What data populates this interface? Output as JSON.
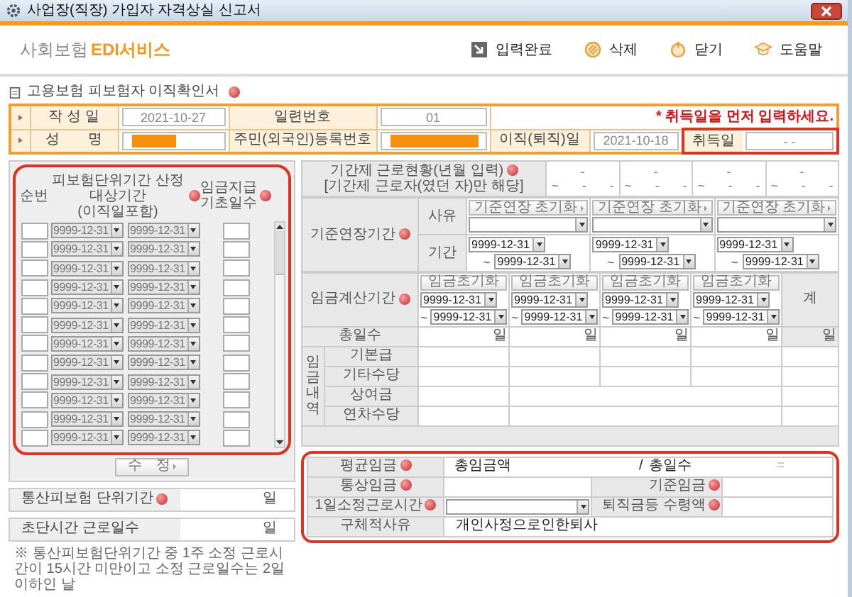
{
  "window": {
    "title": "사업장(직장) 가입자 자격상실 신고서"
  },
  "logo": {
    "prefix": "사회보험",
    "brand": "EDI서비스"
  },
  "toolbar": [
    {
      "kind": "submit",
      "label": "입력완료"
    },
    {
      "kind": "delete",
      "label": "삭제"
    },
    {
      "kind": "close",
      "label": "닫기"
    },
    {
      "kind": "help",
      "label": "도움말"
    }
  ],
  "section": {
    "title": "고용보험 피보험자 이직확인서"
  },
  "info": {
    "written": "작 성 일",
    "written_value": "2021-10-27",
    "serial": "일련번호",
    "serial_value": "01",
    "notice": "* 취득일을 먼저 입력하세요.",
    "name": "성　　명",
    "id": "주민(외국인)등록번호",
    "leave": "이직(퇴직)일",
    "leave_value": "2021-10-18",
    "acq": "취득일",
    "acq_value": "-  -"
  },
  "insured_periods": {
    "columns": [
      "순번",
      "피보험단위기간 산정대상기간\n(이직일포함)",
      "임금지급\n기초일수"
    ],
    "rows": [
      {
        "from": "9999-12-31",
        "to": "9999-12-31",
        "disabled": true
      },
      {
        "from": "9999-12-31",
        "to": "9999-12-31",
        "disabled": true
      },
      {
        "from": "9999-12-31",
        "to": "9999-12-31",
        "disabled": true
      },
      {
        "from": "9999-12-31",
        "to": "9999-12-31",
        "disabled": true
      },
      {
        "from": "9999-12-31",
        "to": "9999-12-31",
        "disabled": true
      },
      {
        "from": "9999-12-31",
        "to": "9999-12-31",
        "disabled": true
      },
      {
        "from": "9999-12-31",
        "to": "9999-12-31",
        "disabled": true
      },
      {
        "from": "9999-12-31",
        "to": "9999-12-31",
        "disabled": true
      },
      {
        "from": "9999-12-31",
        "to": "9999-12-31",
        "disabled": true
      },
      {
        "from": "9999-12-31",
        "to": "9999-12-31",
        "disabled": true
      },
      {
        "from": "9999-12-31",
        "to": "9999-12-31",
        "disabled": true
      },
      {
        "from": "9999-12-31",
        "to": "9999-12-31",
        "disabled": true
      }
    ],
    "edit_button": "수　정"
  },
  "total_period": {
    "label": "통산피보험 단위기간",
    "unit": "일"
  },
  "short_days": {
    "label": "초단시간 근로일수",
    "unit": "일"
  },
  "note": "※ 통산피보험단위기간 중 1주 소정 근로시간이 15시간 미만이고 소정 근로일수는 2일 이하인 날",
  "fixed_term": {
    "label": "기간제 근로현황(년월 입력)",
    "sub": "[기간제 근로자(였던 자)만 해당]",
    "cells": [
      {
        "start": "-",
        "sep": "~",
        "end_year": "-",
        "end_month": "-"
      },
      {
        "start": "-",
        "sep": "~",
        "end_year": "-",
        "end_month": "-"
      },
      {
        "start": "-",
        "sep": "~",
        "end_year": "-",
        "end_month": "-"
      },
      {
        "start": "-",
        "sep": "~",
        "end_year": "-",
        "end_month": "-"
      }
    ]
  },
  "extension": {
    "label": "기준연장기간",
    "reason_label": "사유",
    "period_label": "기간",
    "columns": [
      {
        "reset_button": "기준연장 초기화",
        "from": "9999-12-31",
        "sep": "~",
        "to": "9999-12-31"
      },
      {
        "reset_button": "기준연장 초기화",
        "from": "9999-12-31",
        "sep": "~",
        "to": "9999-12-31"
      },
      {
        "reset_button": "기준연장 초기화",
        "from": "9999-12-31",
        "sep": "~",
        "to": "9999-12-31"
      }
    ]
  },
  "wage_period": {
    "label": "임금계산기간",
    "total_label": "계",
    "columns": [
      {
        "reset_button": "임금초기화",
        "from": "9999-12-31",
        "sep": "~",
        "to": "9999-12-31"
      },
      {
        "reset_button": "임금초기화",
        "from": "9999-12-31",
        "sep": "~",
        "to": "9999-12-31"
      },
      {
        "reset_button": "임금초기화",
        "from": "9999-12-31",
        "sep": "~",
        "to": "9999-12-31"
      },
      {
        "reset_button": "임금초기화",
        "from": "9999-12-31",
        "sep": "~",
        "to": "9999-12-31"
      }
    ]
  },
  "days_row": {
    "label": "총일수",
    "units": [
      "일",
      "일",
      "일",
      "일",
      "일"
    ]
  },
  "wage_items": {
    "group_label": "임금내역",
    "rows": [
      {
        "label": "기본급",
        "kind": "split"
      },
      {
        "label": "기타수당",
        "kind": "split"
      },
      {
        "label": "상여금",
        "kind": "merged"
      },
      {
        "label": "연차수당",
        "kind": "merged"
      }
    ]
  },
  "summary": {
    "avg": "평균임금",
    "total_wage": "총임금액",
    "slash": "/",
    "total_days": "총일수",
    "equals": "=",
    "ordinary": "통상임금",
    "base": "기준임금",
    "hours": "1일소정근로시간",
    "severance": "퇴직금등 수령액",
    "reason": "구체적사유",
    "reason_value": "개인사정으로인한퇴사"
  }
}
